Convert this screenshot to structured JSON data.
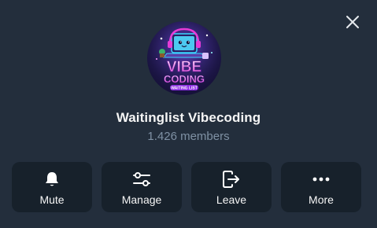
{
  "header": {
    "close_icon": "close-icon"
  },
  "profile": {
    "avatar_text_line1": "VIBE",
    "avatar_text_line2": "CODING",
    "avatar_text_line3": "WAITING LIST",
    "title": "Waitinglist Vibecoding",
    "subtitle": "1.426 members"
  },
  "actions": [
    {
      "label": "Mute",
      "icon": "bell-icon"
    },
    {
      "label": "Manage",
      "icon": "sliders-icon"
    },
    {
      "label": "Leave",
      "icon": "leave-icon"
    },
    {
      "label": "More",
      "icon": "more-dots-icon"
    }
  ],
  "colors": {
    "background": "#232e3c",
    "card": "#17212b",
    "text": "#f5f5f5",
    "muted": "#7f91a4",
    "accent_magenta": "#e63bd6",
    "accent_cyan": "#3ad7ff"
  }
}
